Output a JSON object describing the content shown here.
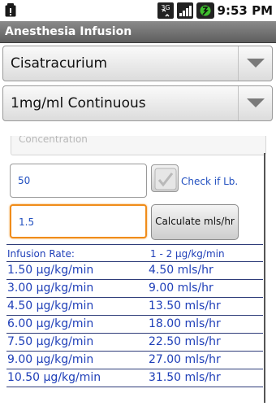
{
  "status_bar": {
    "time": "9:53 PM",
    "network": "3G"
  },
  "app_title": "Anesthesia Infusion",
  "drug_spinner": {
    "selected": "Cisatracurium"
  },
  "dose_spinner": {
    "selected": "1mg/ml Continuous"
  },
  "concentration": {
    "label": "Concentration"
  },
  "weight_input": {
    "value": "50"
  },
  "check_lb": {
    "label": "Check if Lb.",
    "checked": false
  },
  "rate_input": {
    "value": "1.5"
  },
  "calculate_button": {
    "label": "Calculate mls/hr"
  },
  "results": {
    "header": {
      "left": "Infusion Rate:",
      "right": "1 - 2 μg/kg/min"
    },
    "rows": [
      {
        "dose": "1.50 μg/kg/min",
        "rate": "4.50 mls/hr"
      },
      {
        "dose": "3.00 μg/kg/min",
        "rate": "9.00 mls/hr"
      },
      {
        "dose": "4.50 μg/kg/min",
        "rate": "13.50 mls/hr"
      },
      {
        "dose": "6.00 μg/kg/min",
        "rate": "18.00 mls/hr"
      },
      {
        "dose": "7.50 μg/kg/min",
        "rate": "22.50 mls/hr"
      },
      {
        "dose": "9.00 μg/kg/min",
        "rate": "27.00 mls/hr"
      },
      {
        "dose": "10.50 μg/kg/min",
        "rate": "31.50 mls/hr"
      }
    ]
  },
  "colors": {
    "link_blue": "#1f3fb8",
    "focus_orange": "#f08c1a",
    "titlebar_gray": "#6e6e6e"
  }
}
